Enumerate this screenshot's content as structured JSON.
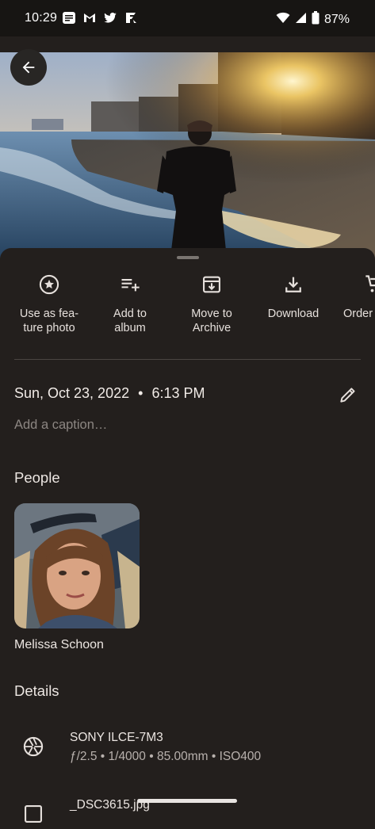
{
  "status_bar": {
    "time": "10:29",
    "battery": "87%",
    "notification_icons": [
      "messages-icon",
      "gmail-icon",
      "twitter-icon",
      "fandango-icon"
    ],
    "system_icons": [
      "wifi-icon",
      "cellular-signal-icon",
      "battery-icon"
    ]
  },
  "viewer": {
    "back_icon": "arrow-left-icon"
  },
  "actions": [
    {
      "label": "Use as fea-\nture photo",
      "icon": "star-circle-icon"
    },
    {
      "label": "Add to\nalbum",
      "icon": "playlist-add-icon"
    },
    {
      "label": "Move to\nArchive",
      "icon": "archive-icon"
    },
    {
      "label": "Download",
      "icon": "download-icon"
    },
    {
      "label": "Order",
      "icon": "cart-icon"
    }
  ],
  "info": {
    "date": "Sun, Oct 23, 2022",
    "separator": "•",
    "time": "6:13 PM",
    "caption_placeholder": "Add a caption…",
    "edit_icon": "pencil-icon"
  },
  "people": {
    "title": "People",
    "items": [
      {
        "name": "Melissa Schoon"
      }
    ]
  },
  "details": {
    "title": "Details",
    "camera": {
      "model": "SONY ILCE-7M3",
      "specs": "ƒ/2.5  •  1/4000  •  85.00mm  •  ISO400",
      "icon": "camera-aperture-icon"
    },
    "file": {
      "name": "_DSC3615.jpg",
      "icon": "image-file-icon"
    }
  },
  "colors": {
    "background": "#231f1d",
    "status_bar": "#171513",
    "text": "#ece6e2",
    "muted_text": "#8c8682"
  }
}
